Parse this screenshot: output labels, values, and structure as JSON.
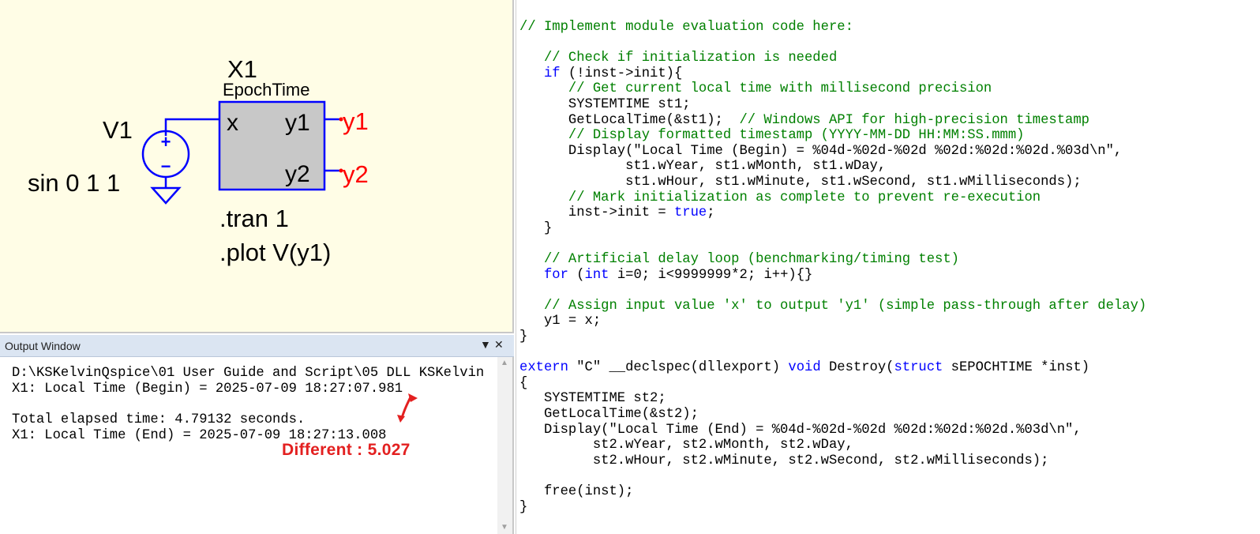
{
  "schematic": {
    "component_ref": "X1",
    "component_name": "EpochTime",
    "port_in": "x",
    "port_out1": "y1",
    "port_out2": "y2",
    "net_y1": "y1",
    "net_y2": "y2",
    "source_ref": "V1",
    "source_value": "sin 0 1 1",
    "plus_sign": "+",
    "minus_sign": "−",
    "directive_tran": ".tran 1",
    "directive_plot": ".plot V(y1)",
    "colors": {
      "background": "#fffde6",
      "wire": "#0000ff",
      "net_label": "#ff0000",
      "block_fill": "#c8c8c8"
    }
  },
  "output_window": {
    "title": "Output Window",
    "pin_icon": "dropdown-arrow-icon",
    "close_icon": "close-icon",
    "lines": [
      "D:\\KSKelvinQspice\\01 User Guide and Script\\05 DLL KSKelvin",
      "X1: Local Time (Begin) = 2025-07-09 18:27:07.981",
      "",
      "Total elapsed time: 4.79132 seconds.",
      "X1: Local Time (End) = 2025-07-09 18:27:13.008"
    ],
    "annotation": "Different :  5.027"
  },
  "editor": {
    "lines": [
      [
        [
          "// Implement module evaluation code here:",
          "c"
        ]
      ],
      [],
      [
        [
          "   // Check if initialization is needed",
          "c"
        ]
      ],
      [
        [
          "   ",
          ""
        ],
        [
          "if",
          "k"
        ],
        [
          " (!inst->init){",
          ""
        ]
      ],
      [
        [
          "      // Get current local time with millisecond precision",
          "c"
        ]
      ],
      [
        [
          "      SYSTEMTIME st1;",
          ""
        ]
      ],
      [
        [
          "      GetLocalTime(&st1);  ",
          ""
        ],
        [
          "// Windows API for high-precision timestamp",
          "c"
        ]
      ],
      [
        [
          "      // Display formatted timestamp (YYYY-MM-DD HH:MM:SS.mmm)",
          "c"
        ]
      ],
      [
        [
          "      Display(\"Local Time (Begin) = %04d-%02d-%02d %02d:%02d:%02d.%03d\\n\",",
          ""
        ]
      ],
      [
        [
          "             st1.wYear, st1.wMonth, st1.wDay,",
          ""
        ]
      ],
      [
        [
          "             st1.wHour, st1.wMinute, st1.wSecond, st1.wMilliseconds);",
          ""
        ]
      ],
      [
        [
          "      // Mark initialization as complete to prevent re-execution",
          "c"
        ]
      ],
      [
        [
          "      inst->init = ",
          ""
        ],
        [
          "true",
          "k"
        ],
        [
          ";",
          ""
        ]
      ],
      [
        [
          "   }",
          ""
        ]
      ],
      [],
      [
        [
          "   // Artificial delay loop (benchmarking/timing test)",
          "c"
        ]
      ],
      [
        [
          "   ",
          ""
        ],
        [
          "for",
          "k"
        ],
        [
          " (",
          ""
        ],
        [
          "int",
          "k"
        ],
        [
          " i=0; i<9999999*2; i++){}",
          ""
        ]
      ],
      [],
      [
        [
          "   // Assign input value 'x' to output 'y1' (simple pass-through after delay)",
          "c"
        ]
      ],
      [
        [
          "   y1 = x;",
          ""
        ]
      ],
      [
        [
          "}",
          ""
        ]
      ],
      [],
      [
        [
          "extern",
          "k"
        ],
        [
          " \"C\" __declspec(dllexport) ",
          ""
        ],
        [
          "void",
          "k"
        ],
        [
          " Destroy(",
          ""
        ],
        [
          "struct",
          "k"
        ],
        [
          " sEPOCHTIME *inst)",
          ""
        ]
      ],
      [
        [
          "{",
          ""
        ]
      ],
      [
        [
          "   SYSTEMTIME st2;",
          ""
        ]
      ],
      [
        [
          "   GetLocalTime(&st2);",
          ""
        ]
      ],
      [
        [
          "   Display(\"Local Time (End) = %04d-%02d-%02d %02d:%02d:%02d.%03d\\n\",",
          ""
        ]
      ],
      [
        [
          "         st2.wYear, st2.wMonth, st2.wDay,",
          ""
        ]
      ],
      [
        [
          "         st2.wHour, st2.wMinute, st2.wSecond, st2.wMilliseconds);",
          ""
        ]
      ],
      [],
      [
        [
          "   free(inst);",
          ""
        ]
      ],
      [
        [
          "}",
          ""
        ]
      ]
    ],
    "colors": {
      "comment": "#008000",
      "keyword": "#0000ff",
      "text": "#000000"
    }
  }
}
